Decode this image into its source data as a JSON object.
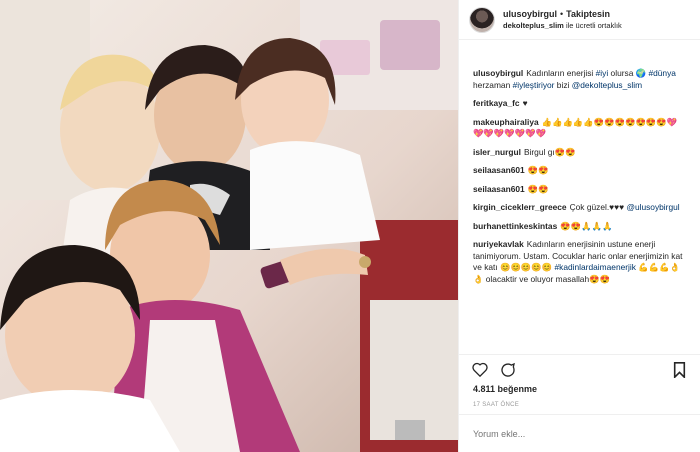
{
  "post": {
    "image_alt": "Selfie of five women smiling together in a salon",
    "header": {
      "username": "ulusoybirgul",
      "separator": "•",
      "follow_status": "Takiptesin",
      "partnership_user": "dekolteplus_slim",
      "partnership_text": "ile ücretli ortaklık"
    },
    "comments": [
      {
        "user": "ulusoybirgul",
        "text": "Kadınların enerjisi #iyi olursa 🌍 #dünya herzaman #iyleştiriyor bizi @dekolteplus_slim"
      },
      {
        "user": "feritkaya_fc",
        "text": "♥"
      },
      {
        "user": "makeuphairaliya",
        "text": "👍👍👍👍👍😍😍😍😍😍😍😍💖💖💖💖💖💖💖💖"
      },
      {
        "user": "isler_nurgul",
        "text": "Birgul gı😍😍"
      },
      {
        "user": "seilaasan601",
        "text": "😍😍"
      },
      {
        "user": "seilaasan601",
        "text": "😍😍"
      },
      {
        "user": "kirgin_ciceklerr_greece",
        "text": "Çok güzel.♥♥♥ @ulusoybirgul"
      },
      {
        "user": "burhanettinkeskintas",
        "text": "😍😍🙏🙏🙏"
      },
      {
        "user": "nuriyekavlak",
        "text": "Kadınların enerjisinin ustune enerji tanimiyorum. Ustam. Cocuklar haric onlar enerjimizin kat ve katı 😊😊😊😊😊 #kadinlardaimaenerjik 💪💪💪👌👌 olacaktir ve oluyor masallah😍😍"
      }
    ],
    "actions": {
      "like_icon": "heart-icon",
      "comment_icon": "comment-icon",
      "save_icon": "bookmark-icon"
    },
    "likes_text": "4.811 beğenme",
    "timestamp": "17 SAAT ÖNCE",
    "add_comment_placeholder": "Yorum ekle...",
    "colors": {
      "text": "#262626",
      "link": "#003569",
      "muted": "#999999",
      "border": "#efefef"
    }
  }
}
